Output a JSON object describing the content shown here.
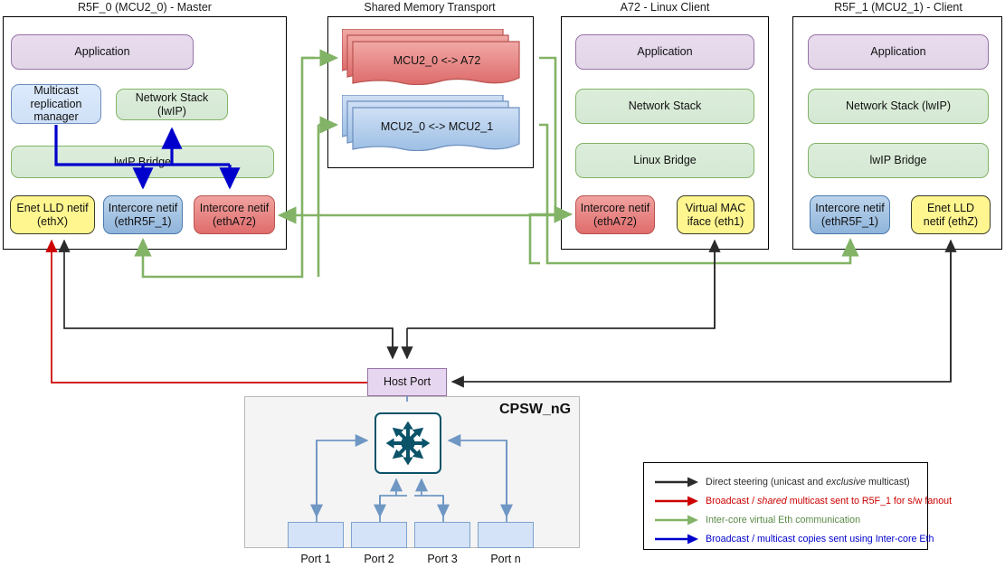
{
  "panels": [
    {
      "id": "r5f0",
      "title": "R5F_0 (MCU2_0) - Master"
    },
    {
      "id": "shm",
      "title": "Shared Memory Transport"
    },
    {
      "id": "a72",
      "title": "A72 - Linux Client"
    },
    {
      "id": "r5f1",
      "title": "R5F_1 (MCU2_1) - Client"
    }
  ],
  "r5f0": {
    "application": "Application",
    "multicast_manager": "Multicast replication manager",
    "network_stack": "Network Stack (lwIP)",
    "bridge": "lwIP Bridge",
    "enet_lld_netif": "Enet LLD netif (ethX)",
    "intercore_r5f1": "Intercore netif (ethR5F_1)",
    "intercore_a72": "Intercore netif (ethA72)"
  },
  "shared_memory": {
    "channel_a72": "MCU2_0 <-> A72",
    "channel_mcu2_1": "MCU2_0 <-> MCU2_1"
  },
  "a72": {
    "application": "Application",
    "network_stack": "Network Stack",
    "bridge": "Linux Bridge",
    "intercore_a72": "Intercore netif (ethA72)",
    "virtual_mac": "Virtual MAC iface (eth1)"
  },
  "r5f1": {
    "application": "Application",
    "network_stack": "Network Stack (lwIP)",
    "bridge": "lwIP Bridge",
    "intercore_r5f1": "Intercore netif (ethR5F_1)",
    "enet_lld_netif": "Enet LLD netif (ethZ)"
  },
  "switch": {
    "host_port": "Host Port",
    "name": "CPSW_nG",
    "icon": "network-switch-icon",
    "ports": [
      "Port 1",
      "Port 2",
      "Port 3",
      "Port n"
    ]
  },
  "legend": {
    "rows": [
      {
        "color": "#2b2b2b",
        "text_parts": [
          "Direct steering (unicast and ",
          "exclusive",
          " multicast)"
        ]
      },
      {
        "color": "#cc0000",
        "text_parts": [
          "Broadcast / ",
          "shared",
          " multicast sent to R5F_1 for s/w fanout"
        ]
      },
      {
        "color": "#82b366",
        "text_parts": [
          "Inter-core virtual Eth communication",
          "",
          ""
        ]
      },
      {
        "color": "#0000cc",
        "text_parts": [
          "Broadcast / multicast copies sent using Inter-core Eth",
          "",
          ""
        ]
      }
    ]
  },
  "colors": {
    "application_fill": "#e1d5e7",
    "application_stroke": "#9673a6",
    "stack_fill": "#d5e8d4",
    "stack_stroke": "#82b366",
    "multicast_fill": "#dae8fc",
    "multicast_stroke": "#6c8ebf",
    "intercore_blue_fill": "#8fb4da",
    "intercore_red_fill": "#e06c6c",
    "enet_lld_fill": "#fff68f",
    "host_port_fill": "#e6d6ef",
    "cpsw_bg": "#f4f4f4",
    "switch_icon": "#0b5369",
    "port_fill": "#d4e3f7",
    "arrow_black": "#2b2b2b",
    "arrow_red": "#cc0000",
    "arrow_green": "#82b366",
    "arrow_blue": "#0000cc"
  }
}
